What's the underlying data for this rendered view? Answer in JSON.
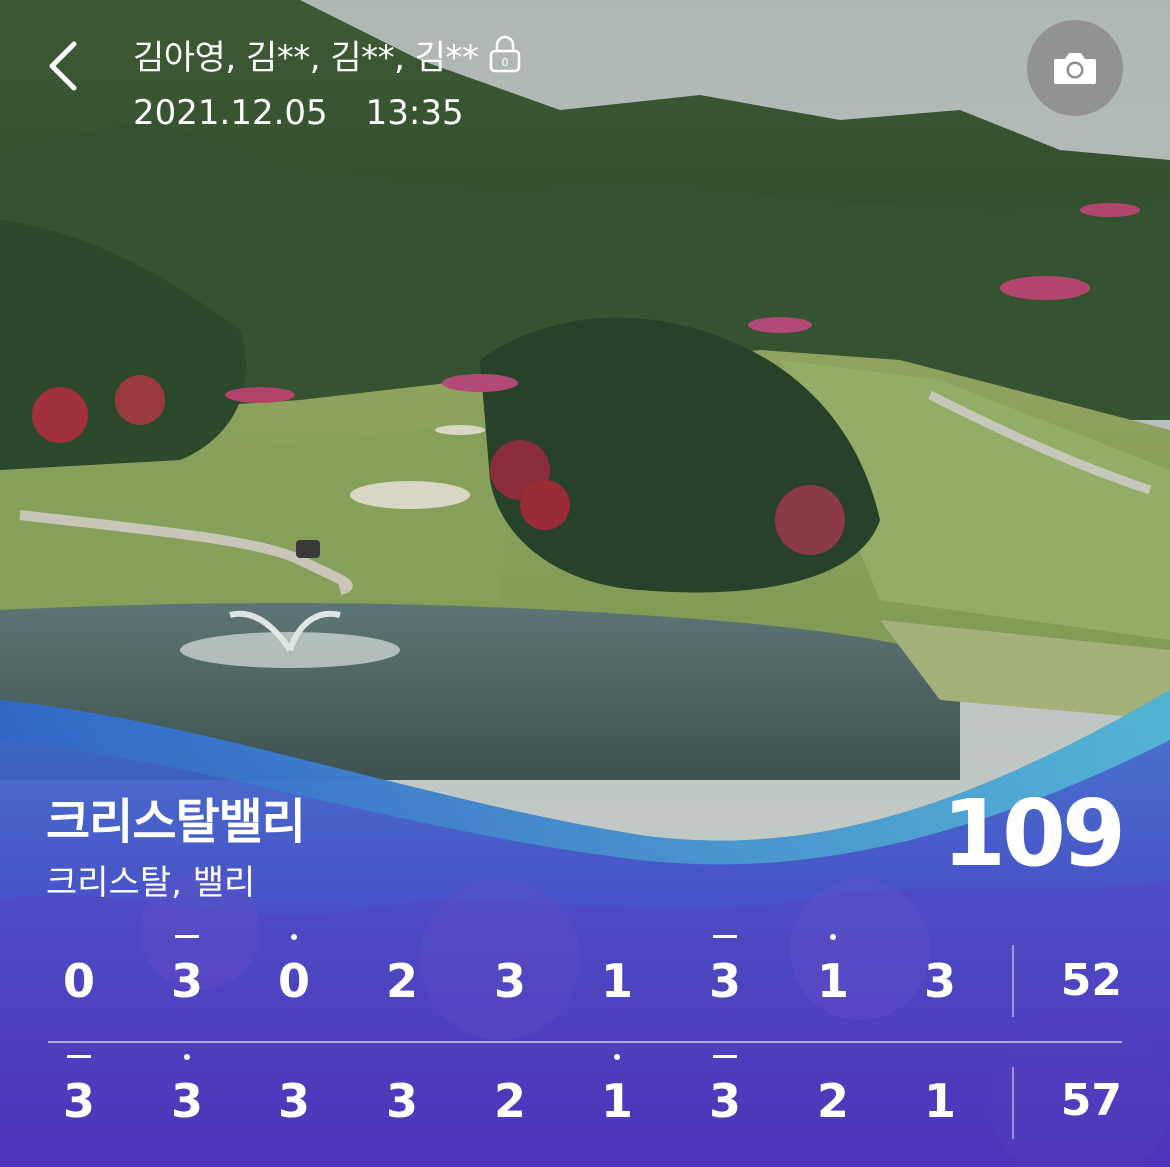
{
  "header": {
    "players": "김아영, 김**, 김**, 김**",
    "lock_icon": "lock-icon",
    "lock_count": "0",
    "date": "2021.12.05",
    "time": "13:35",
    "back_icon": "chevron-left-icon",
    "camera_icon": "camera-icon"
  },
  "course": {
    "name": "크리스탈밸리",
    "courses": "크리스탈, 밸리",
    "total_score": "109"
  },
  "scores": {
    "front": {
      "holes": [
        {
          "value": "0",
          "mark": "none"
        },
        {
          "value": "3",
          "mark": "dash"
        },
        {
          "value": "0",
          "mark": "dot"
        },
        {
          "value": "2",
          "mark": "none"
        },
        {
          "value": "3",
          "mark": "none"
        },
        {
          "value": "1",
          "mark": "none"
        },
        {
          "value": "3",
          "mark": "dash"
        },
        {
          "value": "1",
          "mark": "dot"
        },
        {
          "value": "3",
          "mark": "none"
        }
      ],
      "total": "52"
    },
    "back": {
      "holes": [
        {
          "value": "3",
          "mark": "dash"
        },
        {
          "value": "3",
          "mark": "dot"
        },
        {
          "value": "3",
          "mark": "none"
        },
        {
          "value": "3",
          "mark": "none"
        },
        {
          "value": "2",
          "mark": "none"
        },
        {
          "value": "1",
          "mark": "dot"
        },
        {
          "value": "3",
          "mark": "dash"
        },
        {
          "value": "2",
          "mark": "none"
        },
        {
          "value": "1",
          "mark": "none"
        }
      ],
      "total": "57"
    }
  },
  "colors": {
    "wave_cyan": "#3fb6c8",
    "overlay_blue": "#3b4fc8",
    "overlay_purple": "#4a2fb0"
  }
}
